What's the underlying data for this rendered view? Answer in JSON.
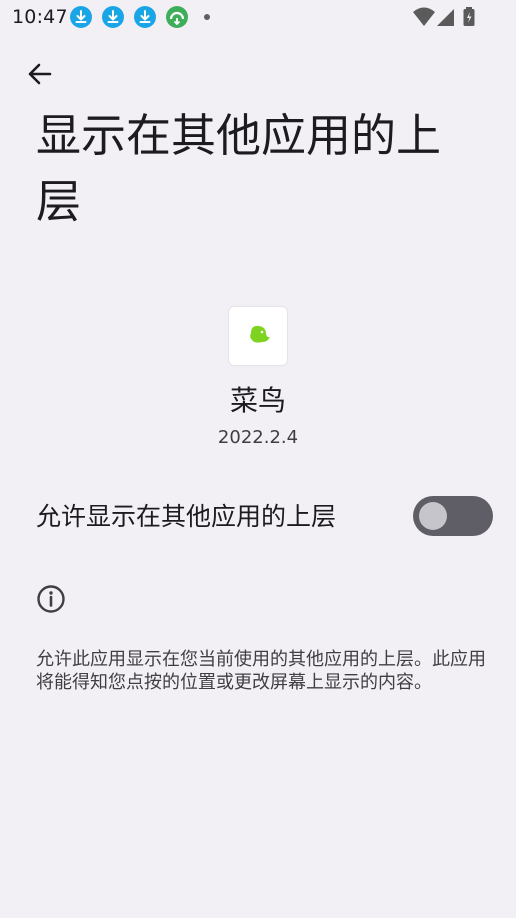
{
  "status_bar": {
    "time": "10:47",
    "icons": [
      "download-icon",
      "download-icon",
      "download-icon",
      "app-store-icon",
      "wifi-icon",
      "signal-icon",
      "battery-icon"
    ],
    "accent_color": "#1aa6e6"
  },
  "header": {
    "back_icon": "arrow-back-icon",
    "title": "显示在其他应用的上层"
  },
  "app": {
    "name": "菜鸟",
    "version": "2022.2.4",
    "icon": "cainiao-bird-icon",
    "icon_color": "#7ed321"
  },
  "setting": {
    "label": "允许显示在其他应用的上层",
    "enabled": false
  },
  "info": {
    "icon": "info-icon",
    "description": "允许此应用显示在您当前使用的其他应用的上层。此应用将能得知您点按的位置或更改屏幕上显示的内容。"
  }
}
